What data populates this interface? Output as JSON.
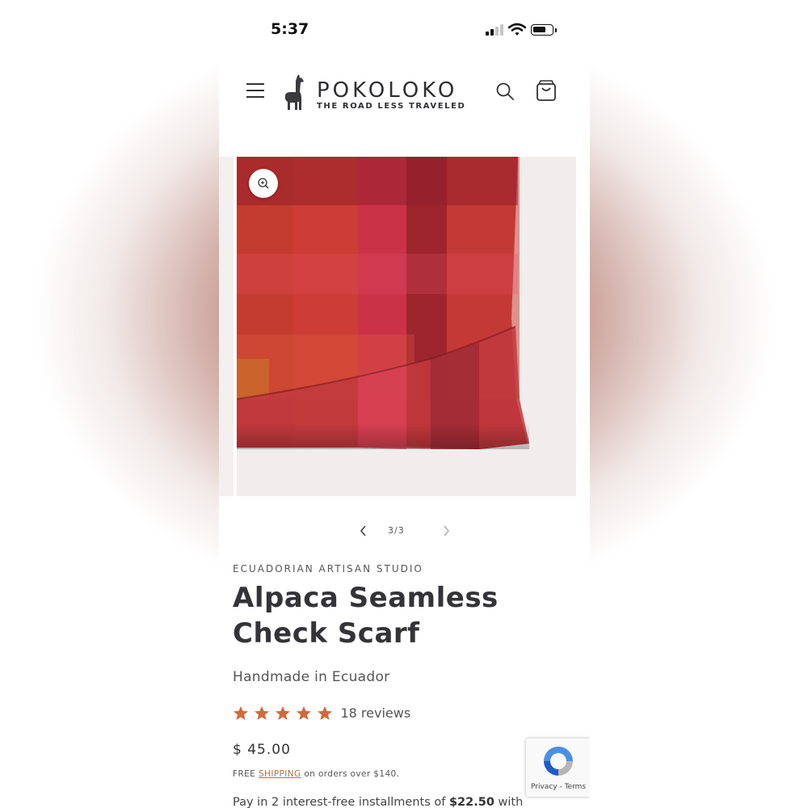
{
  "status_bar": {
    "time": "5:37"
  },
  "header": {
    "brand_name": "POKOLOKO",
    "brand_tagline": "THE ROAD LESS TRAVELED",
    "menu_icon": "hamburger-menu-icon",
    "search_icon": "search-icon",
    "cart_icon": "cart-icon"
  },
  "gallery": {
    "pager": "3/3",
    "zoom_icon": "zoom-in-icon",
    "image_description": "red and pink checked alpaca scarf"
  },
  "product": {
    "vendor": "ECUADORIAN ARTISAN STUDIO",
    "title": "Alpaca Seamless Check Scarf",
    "subtitle": "Handmade in Ecuador",
    "rating": 5,
    "reviews": "18 reviews",
    "price": "$ 45.00",
    "shipping_prefix": "FREE",
    "shipping_link": "SHIPPING",
    "shipping_suffix": "on orders over $140.",
    "installments_prefix": "Pay in 2 interest-free installments of",
    "installments_amount": "$22.50",
    "installments_suffix": "with"
  },
  "recaptcha": {
    "privacy": "Privacy",
    "separator": "-",
    "terms": "Terms"
  },
  "colors": {
    "star": "#d2693c",
    "link": "#b0713f",
    "text": "#333338"
  }
}
